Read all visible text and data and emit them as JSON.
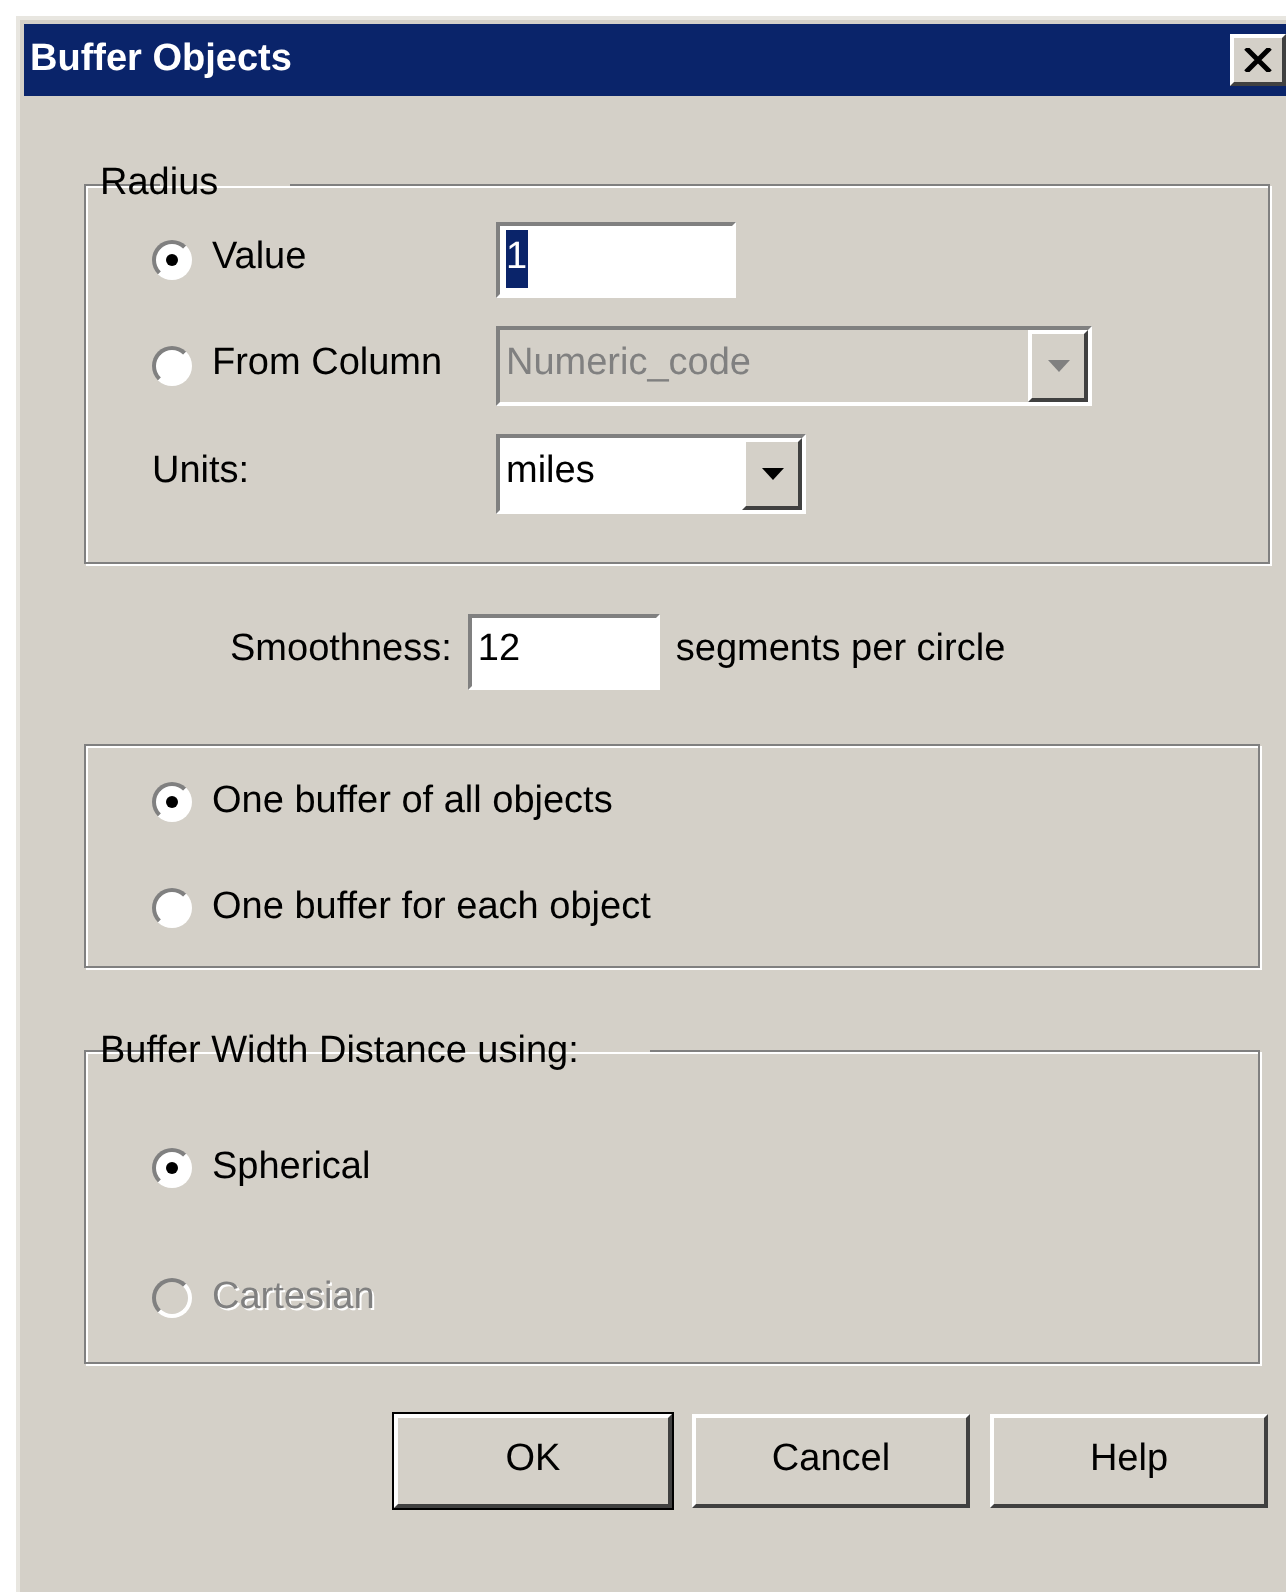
{
  "window": {
    "title": "Buffer Objects"
  },
  "radius": {
    "legend": "Radius",
    "options": [
      {
        "kind": "input",
        "label": "Value",
        "selected": true,
        "value": "1",
        "value_highlighted": true
      },
      {
        "kind": "dropdown",
        "label": "From Column",
        "selected": false,
        "value": "Numeric_code",
        "disabled": true
      }
    ],
    "units": {
      "label": "Units:",
      "value": "miles"
    }
  },
  "smoothness": {
    "label": "Smoothness:",
    "value": "12",
    "suffix": "segments per circle"
  },
  "buffer_mode": [
    {
      "label": "One buffer of all objects",
      "selected": true
    },
    {
      "label": "One buffer for each object",
      "selected": false
    }
  ],
  "distance": {
    "legend": "Buffer Width Distance using:",
    "options": [
      {
        "label": "Spherical",
        "selected": true,
        "disabled": false
      },
      {
        "label": "Cartesian",
        "selected": false,
        "disabled": true
      }
    ]
  },
  "buttons": [
    {
      "label": "OK",
      "default": true
    },
    {
      "label": "Cancel",
      "default": false
    },
    {
      "label": "Help",
      "default": false
    }
  ]
}
